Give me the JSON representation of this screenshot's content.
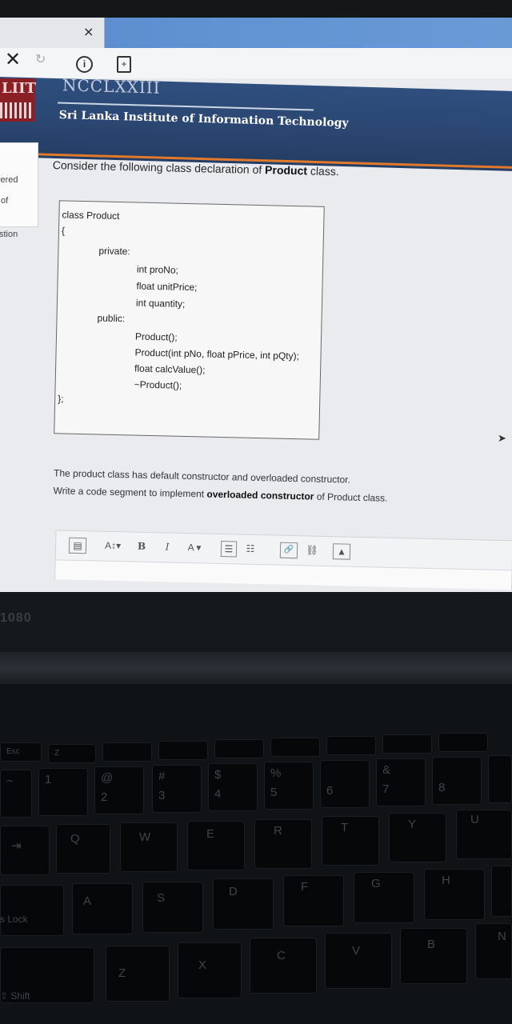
{
  "browser": {
    "tab_close_glyph": "×",
    "nav_close_glyph": "✕",
    "reload_glyph": "↻",
    "info_glyph": "i",
    "page_glyph": "+"
  },
  "header": {
    "logo_text": "LIIT",
    "banner_text": "NCCLXXIII",
    "institute_name": "Sri Lanka Institute of Information Technology"
  },
  "sidebar": {
    "items": [
      "vered",
      "of",
      "stion"
    ]
  },
  "question": {
    "intro_prefix": "Consider the following class declaration of ",
    "intro_bold": "Product",
    "intro_suffix": " class.",
    "code_lines": [
      "class Product",
      "{",
      "private:",
      "int proNo;",
      "float unitPrice;",
      "int quantity;",
      "public:",
      "Product();",
      "Product(int pNo, float pPrice, int pQty);",
      "float calcValue();",
      "~Product();",
      "};"
    ],
    "desc_line1": "The product class has default constructor and overloaded constructor.",
    "desc_line2_prefix": "Write a code segment to implement ",
    "desc_line2_bold": "overloaded constructor",
    "desc_line2_suffix": " of Product class."
  },
  "editor": {
    "toolbar": {
      "format": "▤",
      "font_size": "A↕▾",
      "bold": "B",
      "italic": "I",
      "font_color": "A ▾",
      "bullet_list": "☰",
      "numbered_list": "☷",
      "link": "🔗",
      "unlink": "⛓",
      "image": "▲"
    }
  },
  "laptop": {
    "model_badge": "1080",
    "keys": {
      "esc": "Esc",
      "tilde": "~",
      "one": "1",
      "at": "@",
      "two": "2",
      "hash": "#",
      "three": "3",
      "dollar": "$",
      "four": "4",
      "percent": "%",
      "five": "5",
      "six": "6",
      "amp": "&",
      "seven": "7",
      "eight": "8",
      "tab": "⇥",
      "q": "Q",
      "w": "W",
      "e": "E",
      "r": "R",
      "t": "T",
      "y": "Y",
      "u": "U",
      "caps": "s Lock",
      "a": "A",
      "s": "S",
      "d": "D",
      "f": "F",
      "g": "G",
      "h": "H",
      "shift": "⇧ Shift",
      "z": "Z",
      "x": "X",
      "c": "C",
      "v": "V",
      "b": "B",
      "n": "N"
    }
  }
}
